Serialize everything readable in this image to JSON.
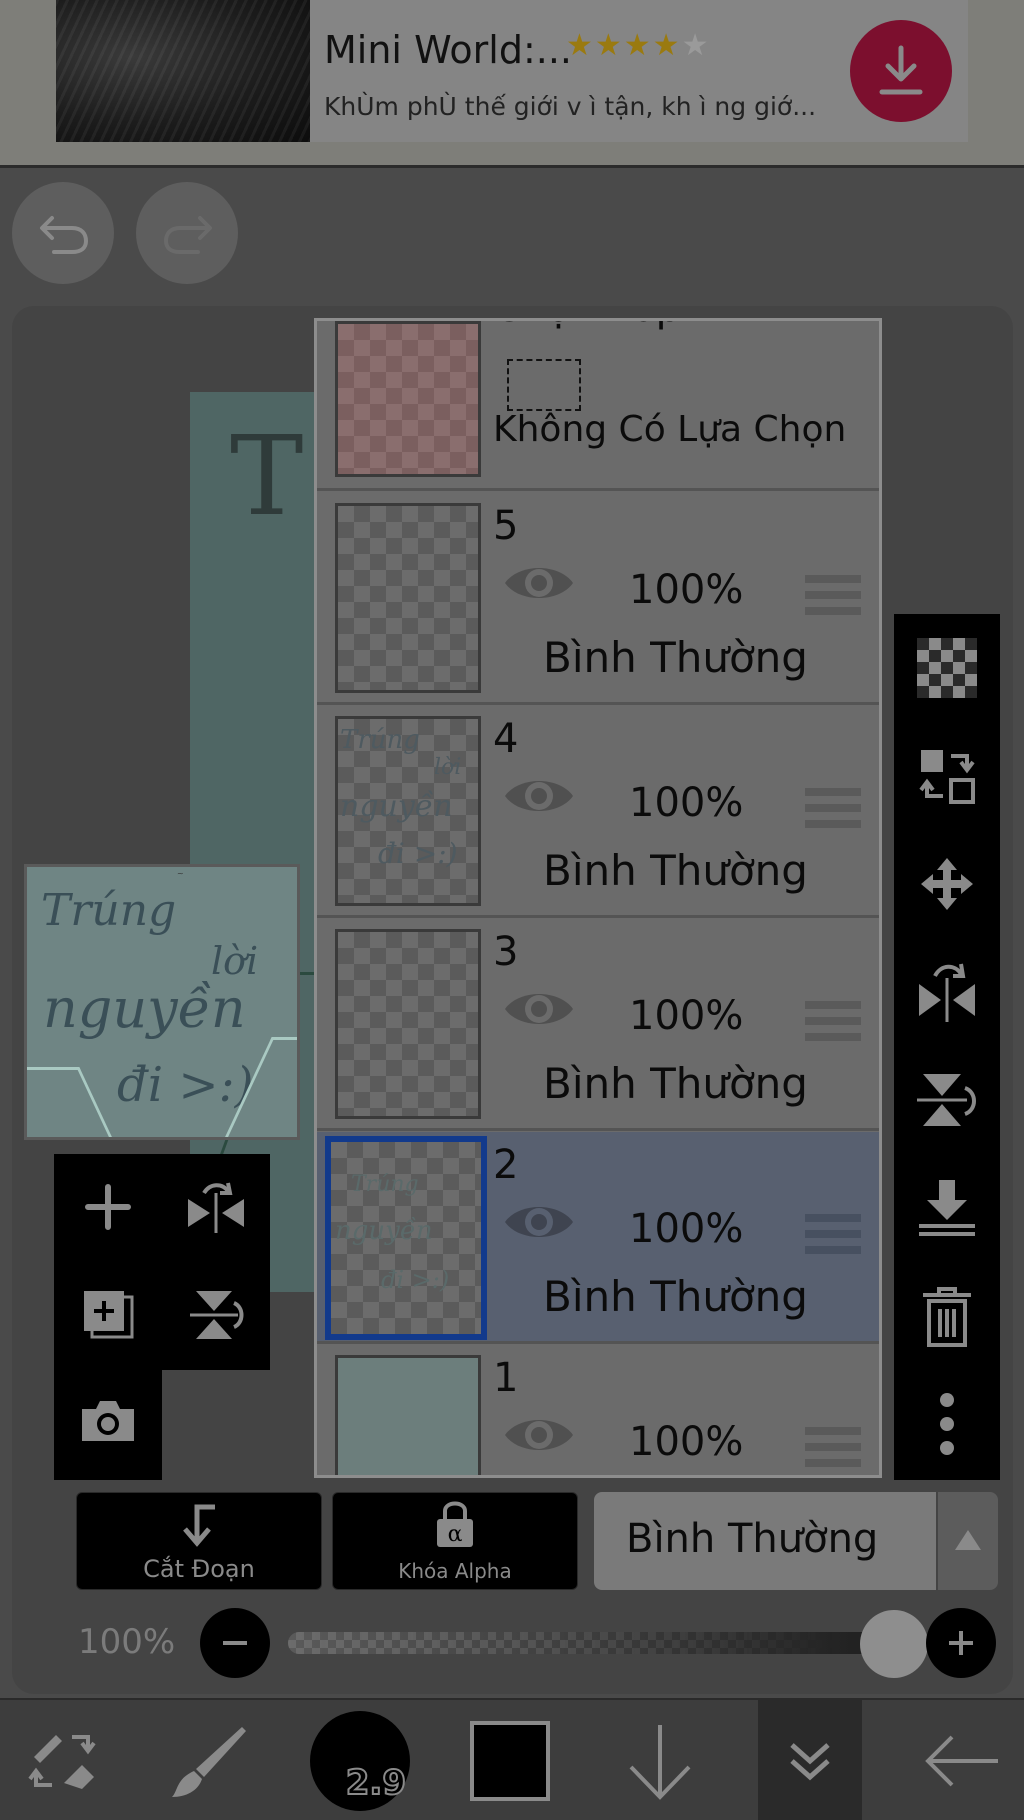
{
  "ad": {
    "title": "Mini World:...",
    "rating": 4,
    "rating_max": 5,
    "star_filled": "★★★★",
    "star_empty": "★",
    "description": "KhÙm phÙ thế giới v ì  tận, kh ì ng giớ...",
    "accent": "#7c0f2e"
  },
  "history": {
    "undo_icon": "undo-icon",
    "redo_icon": "redo-icon"
  },
  "canvas_preview": {
    "words": [
      "Trúng",
      "lời",
      "nguyền",
      "đi >:)"
    ]
  },
  "layers_panel": {
    "selection_layer": {
      "title": "Chọn Lớp",
      "status": "Không Có Lựa Chọn"
    },
    "layers": [
      {
        "number": "5",
        "opacity": "100%",
        "blend": "Bình Thường",
        "visible": true,
        "selected": false,
        "thumb": "transparent"
      },
      {
        "number": "4",
        "opacity": "100%",
        "blend": "Bình Thường",
        "visible": true,
        "selected": false,
        "thumb": "text"
      },
      {
        "number": "3",
        "opacity": "100%",
        "blend": "Bình Thường",
        "visible": true,
        "selected": false,
        "thumb": "transparent"
      },
      {
        "number": "2",
        "opacity": "100%",
        "blend": "Bình Thường",
        "visible": true,
        "selected": true,
        "thumb": "faint-text"
      },
      {
        "number": "1",
        "opacity": "100%",
        "blend": "",
        "visible": true,
        "selected": false,
        "thumb": "solid"
      }
    ],
    "selected_accent": "#123a8c"
  },
  "right_toolbar": [
    "transparency-icon",
    "layer-swap-icon",
    "move-icon",
    "flip-horizontal-icon",
    "flip-vertical-icon",
    "merge-down-icon",
    "trash-icon",
    "more-vertical-icon"
  ],
  "left_toolbar": [
    "add-layer-icon",
    "flip-layer-h-icon",
    "add-copy-layer-icon",
    "flip-layer-v-icon",
    "camera-icon"
  ],
  "layer_controls": {
    "clip_label": "Cắt Đoạn",
    "alpha_lock_label": "Khóa Alpha",
    "blend_mode": "Bình Thường"
  },
  "opacity": {
    "label": "100%",
    "value": 100
  },
  "bottom_toolbar": {
    "brush_size": "2.9",
    "color": "#000000",
    "tools": [
      "tool-switch-icon",
      "brush-icon",
      "brush-size",
      "color-swatch",
      "arrow-down-icon",
      "layers-icon",
      "back-arrow-icon"
    ]
  }
}
